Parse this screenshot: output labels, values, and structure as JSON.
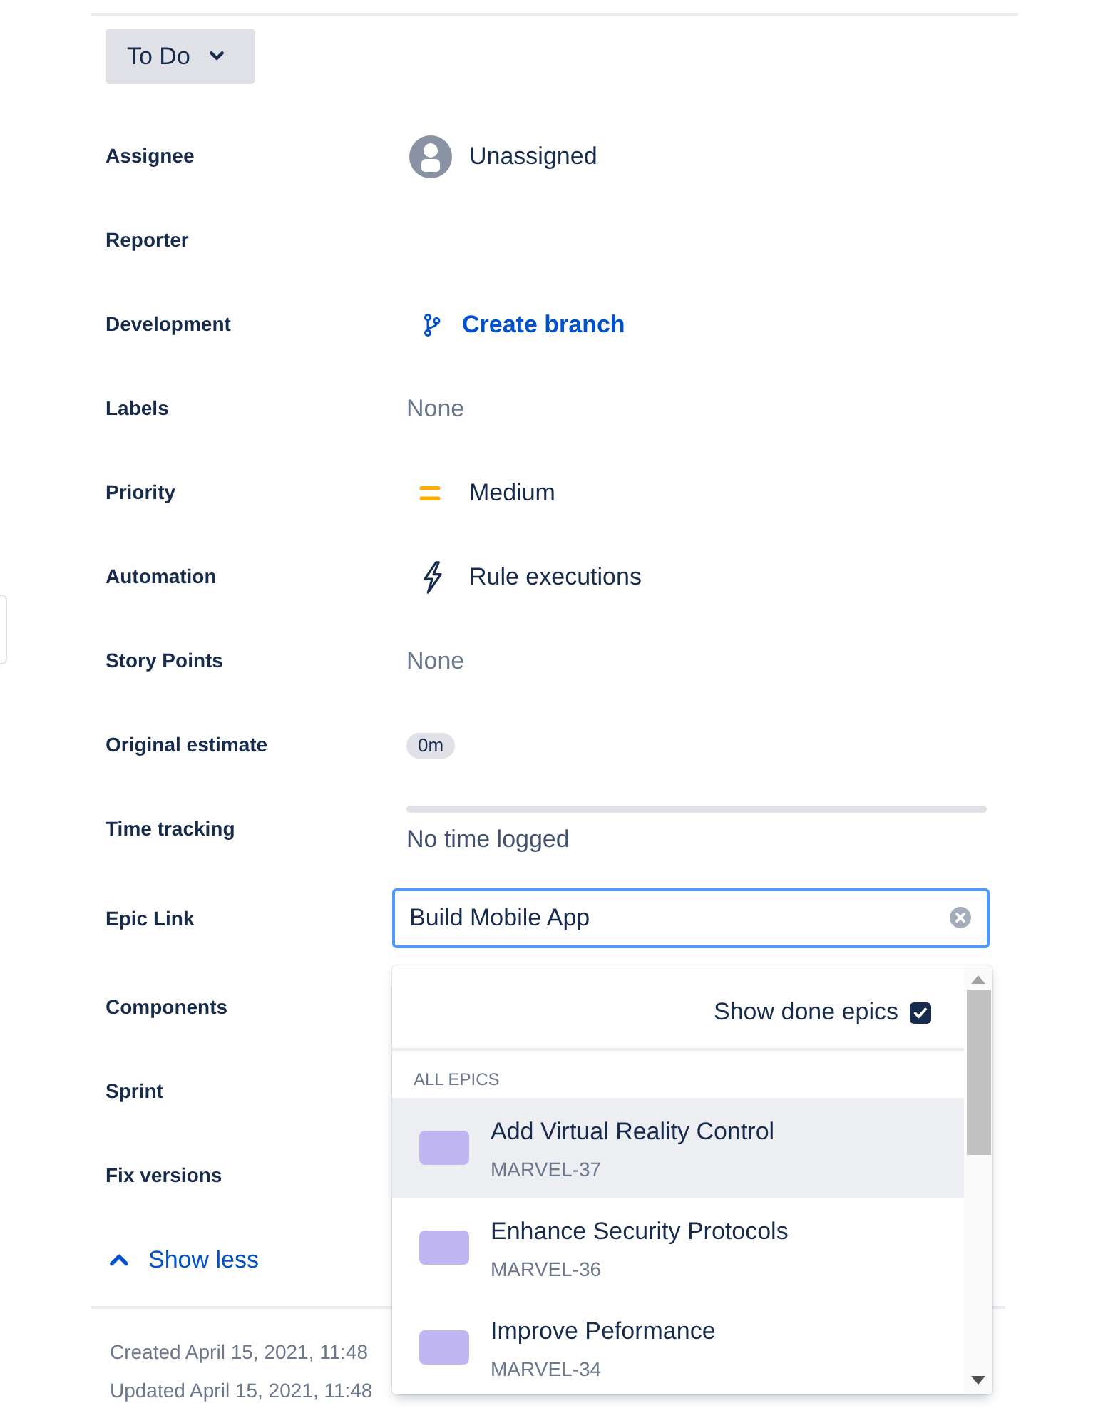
{
  "status_button": {
    "label": "To Do"
  },
  "fields": [
    {
      "kind": "user",
      "label": "Assignee",
      "value": "Unassigned"
    },
    {
      "kind": "empty",
      "label": "Reporter"
    },
    {
      "kind": "link",
      "label": "Development",
      "value": "Create branch"
    },
    {
      "kind": "none",
      "label": "Labels",
      "value": "None"
    },
    {
      "kind": "priority",
      "label": "Priority",
      "value": "Medium"
    },
    {
      "kind": "automation",
      "label": "Automation",
      "value": "Rule executions"
    },
    {
      "kind": "none",
      "label": "Story Points",
      "value": "None"
    },
    {
      "kind": "badge",
      "label": "Original estimate",
      "value": "0m"
    },
    {
      "kind": "progress",
      "label": "Time tracking",
      "level": 0,
      "value": "No time logged"
    },
    {
      "kind": "input",
      "label": "Epic Link",
      "value": "Build Mobile App"
    },
    {
      "kind": "empty",
      "label": "Components"
    },
    {
      "kind": "empty",
      "label": "Sprint"
    },
    {
      "kind": "empty",
      "label": "Fix versions"
    }
  ],
  "epic_dropdown": {
    "show_done": {
      "label": "Show done epics",
      "checked": true
    },
    "section_label": "ALL EPICS",
    "items": [
      {
        "title": "Add Virtual Reality Control",
        "key": "MARVEL-37",
        "color": "#c0b6f2",
        "selected": true
      },
      {
        "title": "Enhance Security Protocols",
        "key": "MARVEL-36",
        "color": "#c0b6f2",
        "selected": false
      },
      {
        "title": "Improve Peformance",
        "key": "MARVEL-34",
        "color": "#c0b6f2",
        "selected": false
      }
    ]
  },
  "show_less": {
    "label": "Show less"
  },
  "footer": {
    "created": "Created April 15, 2021, 11:48",
    "updated": "Updated April 15, 2021, 11:48"
  }
}
